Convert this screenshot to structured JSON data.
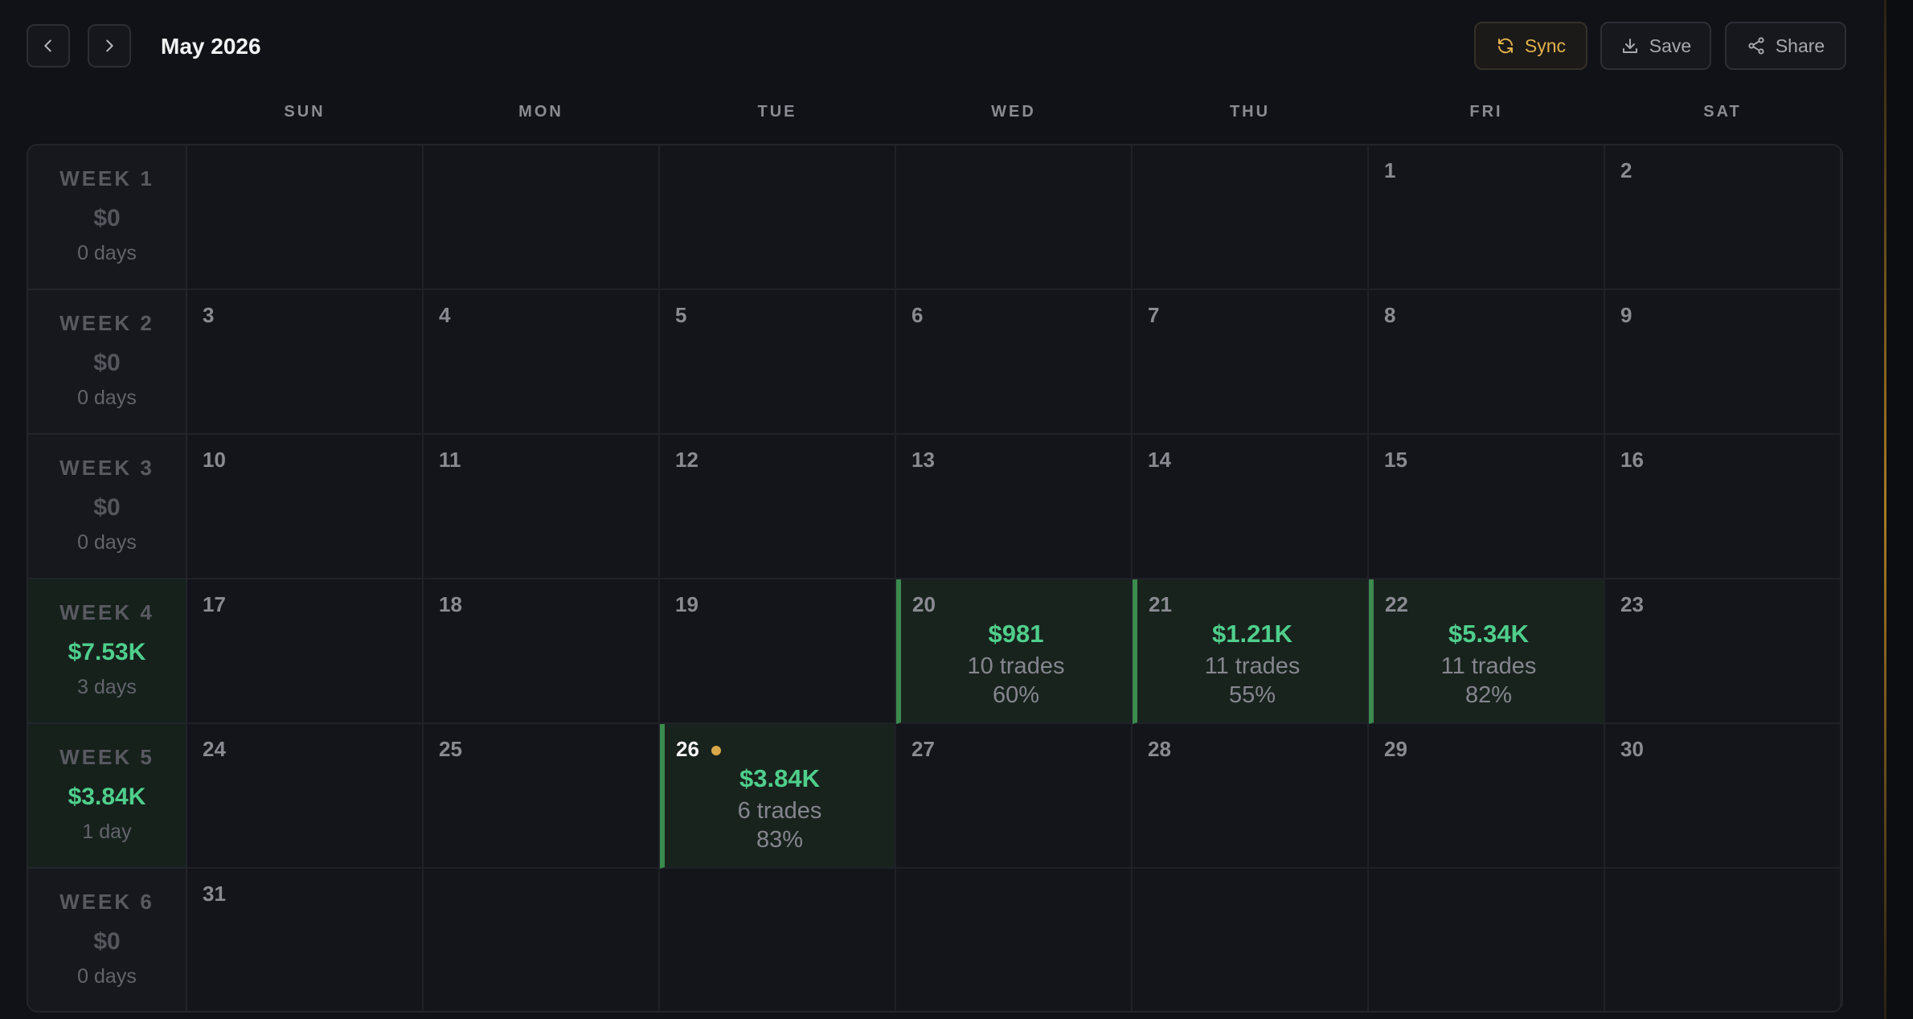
{
  "header": {
    "month_title": "May 2026",
    "buttons": {
      "sync": "Sync",
      "save": "Save",
      "share": "Share"
    }
  },
  "colors": {
    "profit": "#4fcf8c",
    "sync_accent": "#e2b24a",
    "today_dot": "#d8a84a",
    "traded_border": "#3b8a4e"
  },
  "weekdays": [
    "SUN",
    "MON",
    "TUE",
    "WED",
    "THU",
    "FRI",
    "SAT"
  ],
  "weeks": [
    {
      "label": "WEEK 1",
      "amount": "$0",
      "days": "0 days",
      "active": false,
      "dates": [
        "",
        "",
        "",
        "",
        "",
        "1",
        "2"
      ]
    },
    {
      "label": "WEEK 2",
      "amount": "$0",
      "days": "0 days",
      "active": false,
      "dates": [
        "3",
        "4",
        "5",
        "6",
        "7",
        "8",
        "9"
      ]
    },
    {
      "label": "WEEK 3",
      "amount": "$0",
      "days": "0 days",
      "active": false,
      "dates": [
        "10",
        "11",
        "12",
        "13",
        "14",
        "15",
        "16"
      ]
    },
    {
      "label": "WEEK 4",
      "amount": "$7.53K",
      "days": "3 days",
      "active": true,
      "dates": [
        "17",
        "18",
        "19",
        "20",
        "21",
        "22",
        "23"
      ]
    },
    {
      "label": "WEEK 5",
      "amount": "$3.84K",
      "days": "1 day",
      "active": true,
      "dates": [
        "24",
        "25",
        "26",
        "27",
        "28",
        "29",
        "30"
      ]
    },
    {
      "label": "WEEK 6",
      "amount": "$0",
      "days": "0 days",
      "active": false,
      "dates": [
        "31",
        "",
        "",
        "",
        "",
        "",
        ""
      ]
    }
  ],
  "trading_days": {
    "20": {
      "pnl": "$981",
      "trades": "10 trades",
      "win_rate": "60%"
    },
    "21": {
      "pnl": "$1.21K",
      "trades": "11 trades",
      "win_rate": "55%"
    },
    "22": {
      "pnl": "$5.34K",
      "trades": "11 trades",
      "win_rate": "82%"
    },
    "26": {
      "pnl": "$3.84K",
      "trades": "6 trades",
      "win_rate": "83%",
      "today": true
    }
  },
  "icons": {
    "prev": "chevron-left-icon",
    "next": "chevron-right-icon",
    "sync": "refresh-icon",
    "save": "download-icon",
    "share": "share-icon"
  }
}
